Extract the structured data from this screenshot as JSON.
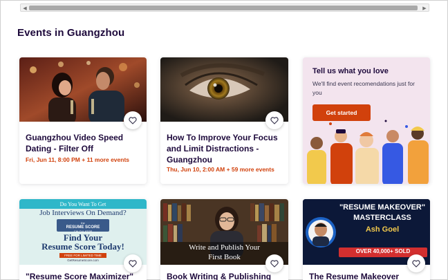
{
  "section": {
    "title": "Events in Guangzhou"
  },
  "cards": [
    {
      "title": "Guangzhou Video Speed Dating - Filter Off",
      "date": "Fri, Jun 11, 8:00 PM + 11 more events"
    },
    {
      "title": "How To Improve Your Focus and Limit Distractions - Guangzhou",
      "date": "Thu, Jun 10, 2:00 AM + 59 more events"
    },
    {
      "title": "\"Resume Score Maximizer\" —",
      "date": ""
    },
    {
      "title": "Book Writing & Publishing",
      "date": ""
    },
    {
      "title": "The Resume Makeover",
      "date": ""
    }
  ],
  "promo": {
    "title": "Tell us what you love",
    "text": "We'll find event recomendations just for you",
    "cta": "Get started"
  },
  "images": {
    "resume_line1": "Do You Want To Get",
    "resume_line2": "Job Interviews On Demand?",
    "resume_banner_small": "the",
    "resume_banner": "RESUME SCORE",
    "resume_banner_sub": "CALCULATOR",
    "resume_line3": "Find Your",
    "resume_line4": "Resume Score Today!",
    "resume_free": "FREE FOR LIMITED TIME",
    "resume_url": "GetResumeScore.com",
    "book_line1": "Write and Publish Your",
    "book_line2": "First Book",
    "makeover_title": "\"RESUME MAKEOVER\"",
    "makeover_sub": "MASTERCLASS",
    "makeover_name": "Ash Goel",
    "makeover_sold": "OVER 40,000+ SOLD"
  },
  "colors": {
    "accent": "#d1410c",
    "heading": "#1e0a3c",
    "promo_bg": "#f3e4ee"
  }
}
